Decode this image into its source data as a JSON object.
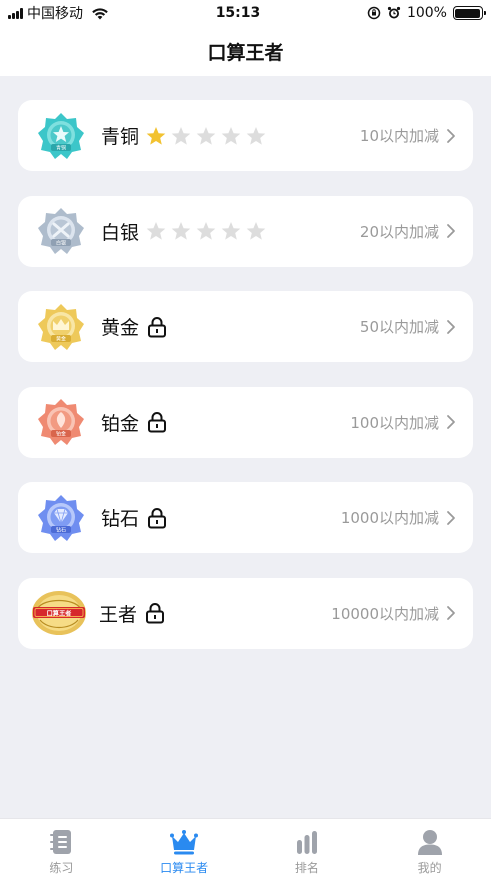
{
  "status_bar": {
    "carrier": "中国移动",
    "time": "15:13",
    "battery": "100%"
  },
  "nav": {
    "title": "口算王者"
  },
  "levels": [
    {
      "name": "青铜",
      "range": "10以内加减",
      "stars_filled": 1,
      "stars_total": 5,
      "locked": false,
      "badge_text": "青铜",
      "color": "#3cc6c9"
    },
    {
      "name": "白银",
      "range": "20以内加减",
      "stars_filled": 0,
      "stars_total": 5,
      "locked": false,
      "badge_text": "白银",
      "color": "#a9b8c9"
    },
    {
      "name": "黄金",
      "range": "50以内加减",
      "locked": true,
      "badge_text": "黄金",
      "color": "#f0cd5a"
    },
    {
      "name": "铂金",
      "range": "100以内加减",
      "locked": true,
      "badge_text": "铂金",
      "color": "#f08a70"
    },
    {
      "name": "钻石",
      "range": "1000以内加减",
      "locked": true,
      "badge_text": "钻石",
      "color": "#6f8ef0"
    },
    {
      "name": "王者",
      "range": "10000以内加减",
      "locked": true,
      "badge_text": "口算王者",
      "color": "#d6282c"
    }
  ],
  "tabs": [
    {
      "label": "练习",
      "icon": "book-icon",
      "active": false
    },
    {
      "label": "口算王者",
      "icon": "crown-icon",
      "active": true
    },
    {
      "label": "排名",
      "icon": "bar-chart-icon",
      "active": false
    },
    {
      "label": "我的",
      "icon": "person-icon",
      "active": false
    }
  ],
  "colors": {
    "accent": "#2a8af0",
    "star_filled": "#f2c230",
    "star_empty": "#dddddd"
  }
}
